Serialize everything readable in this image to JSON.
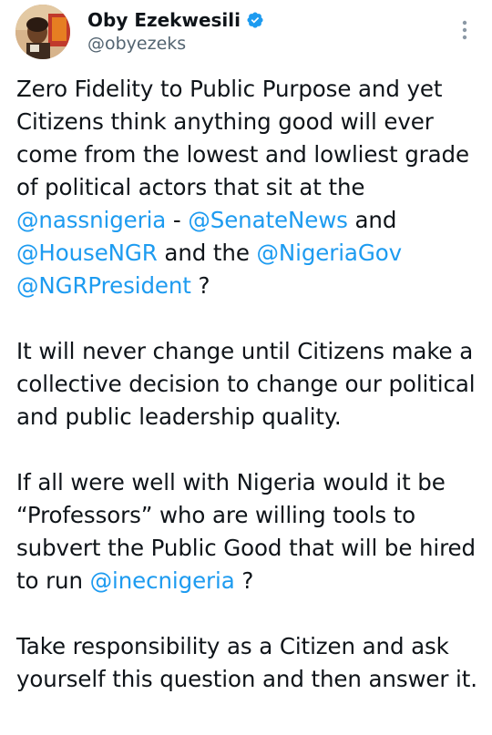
{
  "author": {
    "display_name": "Oby Ezekwesili",
    "handle": "@obyezeks",
    "verified": true,
    "avatar_icon": "profile-photo"
  },
  "colors": {
    "mention": "#1d9bf0",
    "verified_badge": "#1d9bf0",
    "secondary_text": "#536471"
  },
  "menu": {
    "icon": "more-vertical-icon"
  },
  "tweet": {
    "p1": {
      "text_a": "Zero Fidelity to Public Purpose and yet Citizens think anything good will ever come from the lowest and lowliest grade of political actors that sit at the ",
      "mention_1": "@nassnigeria",
      "text_b": " - ",
      "mention_2": "@SenateNews",
      "text_c": " and ",
      "mention_3": "@HouseNGR",
      "text_d": " and the ",
      "mention_4": "@NigeriaGov",
      "text_e": " ",
      "mention_5": "@NGRPresident",
      "text_f": " ?"
    },
    "p2": "It will never change until Citizens make a collective decision to change our political and public leadership quality.",
    "p3": {
      "text_a": "If all were well with Nigeria would it be “Professors” who are willing tools to subvert the Public Good that will be hired to run ",
      "mention_1": "@inecnigeria",
      "text_b": " ?"
    },
    "p4": "Take responsibility as a Citizen and ask yourself this question and then answer it."
  }
}
